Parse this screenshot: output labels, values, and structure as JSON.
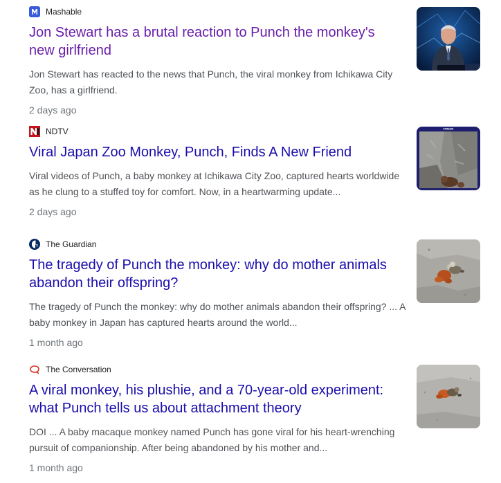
{
  "results": [
    {
      "source": "Mashable",
      "favicon": "mashable-logo-icon",
      "title_line1": "Jon Stewart has a brutal reaction to Punch the monkey's",
      "title_line2": "new girlfriend",
      "snippet_line1": "Jon Stewart has reacted to the news that Punch, the viral monkey from Ichikawa City",
      "snippet_line2": "Zoo, has a girlfriend.",
      "time": "2 days ago",
      "visited": true,
      "thumbnail": "host-at-news-desk-image"
    },
    {
      "source": "NDTV",
      "favicon": "ndtv-logo-icon",
      "title_line1": "Viral Japan Zoo Monkey, Punch, Finds A New Friend",
      "title_line2": "",
      "snippet_line1": "Viral videos of Punch, a baby monkey at Ichikawa City Zoo, captured hearts worldwide",
      "snippet_line2": "as he clung to a stuffed toy for comfort. Now, in a heartwarming update...",
      "time": "2 days ago",
      "visited": false,
      "thumbnail": "monkey-enclosure-image",
      "thumbnail_caption": "FRIEND"
    },
    {
      "source": "The Guardian",
      "favicon": "guardian-logo-icon",
      "title_line1": "The tragedy of Punch the monkey: why do mother animals",
      "title_line2": "abandon their offspring?",
      "snippet_line1": "The tragedy of Punch the monkey: why do mother animals abandon their offspring? ... A",
      "snippet_line2": "baby monkey in Japan has captured hearts around the world...",
      "time": "1 month ago",
      "visited": false,
      "thumbnail": "monkey-with-plushie-image"
    },
    {
      "source": "The Conversation",
      "favicon": "conversation-logo-icon",
      "title_line1": "A viral monkey, his plushie, and a 70-year-old experiment:",
      "title_line2": "what Punch tells us about attachment theory",
      "snippet_line1": "DOI ... A baby macaque monkey named Punch has gone viral for his heart-wrenching",
      "snippet_line2": "pursuit of companionship. After being abandoned by his mother and...",
      "time": "1 month ago",
      "visited": false,
      "thumbnail": "monkey-on-ground-image"
    }
  ],
  "colors": {
    "visited_link": "#681da8",
    "link": "#1a0dab",
    "snippet": "#4d5156",
    "time": "#70757a",
    "mashable_brand": "#3a5bd9",
    "ndtv_brand": "#c4151c",
    "guardian_brand": "#052962",
    "conversation_brand": "#d8352a"
  }
}
